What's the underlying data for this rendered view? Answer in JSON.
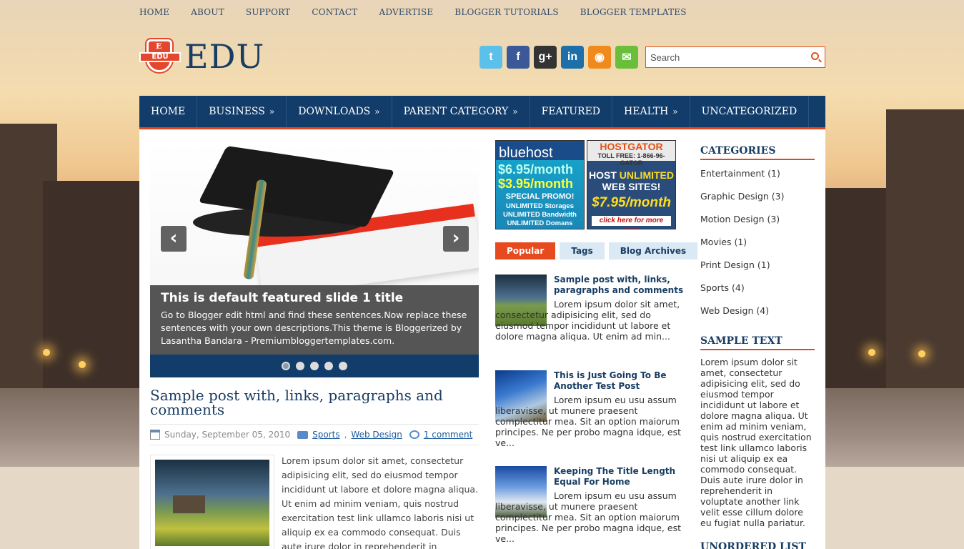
{
  "topnav": [
    "HOME",
    "ABOUT",
    "SUPPORT",
    "CONTACT",
    "ADVERTISE",
    "BLOGGER TUTORIALS",
    "BLOGGER TEMPLATES"
  ],
  "logo": {
    "badge_letter": "E",
    "badge_text": "EDU",
    "wordmark": "EDU"
  },
  "social": [
    {
      "name": "twitter",
      "glyph": "t",
      "color": "#5bc0ea"
    },
    {
      "name": "facebook",
      "glyph": "f",
      "color": "#3b5998"
    },
    {
      "name": "google-plus",
      "glyph": "g+",
      "color": "#333333"
    },
    {
      "name": "linkedin",
      "glyph": "in",
      "color": "#1c6fa8"
    },
    {
      "name": "rss",
      "glyph": "◉",
      "color": "#f08a1c"
    },
    {
      "name": "email",
      "glyph": "✉",
      "color": "#6abf3a"
    }
  ],
  "search": {
    "placeholder": "Search"
  },
  "mainnav": [
    {
      "label": "HOME",
      "arrow": ""
    },
    {
      "label": "BUSINESS",
      "arrow": "»"
    },
    {
      "label": "DOWNLOADS",
      "arrow": "»"
    },
    {
      "label": "PARENT CATEGORY",
      "arrow": "»"
    },
    {
      "label": "FEATURED",
      "arrow": ""
    },
    {
      "label": "HEALTH",
      "arrow": "»"
    },
    {
      "label": "UNCATEGORIZED",
      "arrow": ""
    }
  ],
  "slider": {
    "title": "This is default featured slide 1 title",
    "description": "Go to Blogger edit html and find these sentences.Now replace these sentences with your own descriptions.This theme is Bloggerized by Lasantha Bandara - Premiumbloggertemplates.com.",
    "prev": "‹",
    "next": "›",
    "dots": 5,
    "active_dot": 1
  },
  "post": {
    "title": "Sample post with, links, paragraphs and comments",
    "date": "Sunday, September 05, 2010",
    "labels": [
      "Sports",
      "Web Design"
    ],
    "comments": "1 comment",
    "body": "Lorem ipsum dolor sit amet, consectetur adipisicing elit, sed do eiusmod tempor incididunt ut labore et dolore magna aliqua. Ut enim ad minim veniam, quis nostrud exercitation test link ullamco laboris nisi ut aliquip ex ea commodo consequat. Duis aute irure dolor in reprehenderit in voluptate"
  },
  "ads": {
    "bluehost": {
      "name": "bluehost",
      "old_price": "$6.95/month",
      "new_price": "$3.95/month",
      "promo": "SPECIAL PROMO!",
      "lines": [
        "UNLIMITED Storages",
        "UNLIMITED Bandwidth",
        "UNLIMITED Domans"
      ]
    },
    "hostgator": {
      "name": "HOSTGATOR",
      "phone": "TOLL FREE: 1-866-96-GATOR",
      "line1": "HOST",
      "line1b": "UNLIMITED",
      "line2": "WEB SITES!",
      "price": "$7.95/month",
      "cta": "click here for more info!"
    }
  },
  "tabs": [
    {
      "label": "Popular",
      "active": true
    },
    {
      "label": "Tags",
      "active": false
    },
    {
      "label": "Blog Archives",
      "active": false
    }
  ],
  "popular": [
    {
      "title": "Sample post with, links, paragraphs and comments",
      "excerpt": "Lorem ipsum dolor sit amet, consectetur adipisicing elit, sed do eiusmod tempor incididunt ut labore et dolore magna aliqua. Ut enim ad min..."
    },
    {
      "title": "This is Just Going To Be Another Test Post",
      "excerpt": "Lorem ipsum eu usu assum liberavisse, ut munere praesent complectitur mea. Sit an option maiorum principes. Ne per probo magna idque, est ve..."
    },
    {
      "title": "Keeping The Title Length Equal For Home",
      "excerpt": "Lorem ipsum eu usu assum liberavisse, ut munere praesent complectitur mea. Sit an option maiorum principes. Ne per probo magna idque, est ve..."
    }
  ],
  "sidebar": {
    "categories_title": "CATEGORIES",
    "categories": [
      "Entertainment (1)",
      "Graphic Design (3)",
      "Motion Design (3)",
      "Movies (1)",
      "Print Design (1)",
      "Sports (4)",
      "Web Design (4)"
    ],
    "sample_title": "SAMPLE TEXT",
    "sample_text": "Lorem ipsum dolor sit amet, consectetur adipisicing elit, sed do eiusmod tempor incididunt ut labore et dolore magna aliqua. Ut enim ad minim veniam, quis nostrud exercitation test link ullamco laboris nisi ut aliquip ex ea commodo consequat. Duis aute irure dolor in reprehenderit in voluptate another link velit esse cillum dolore eu fugiat nulla pariatur.",
    "list_title": "UNORDERED LIST"
  }
}
